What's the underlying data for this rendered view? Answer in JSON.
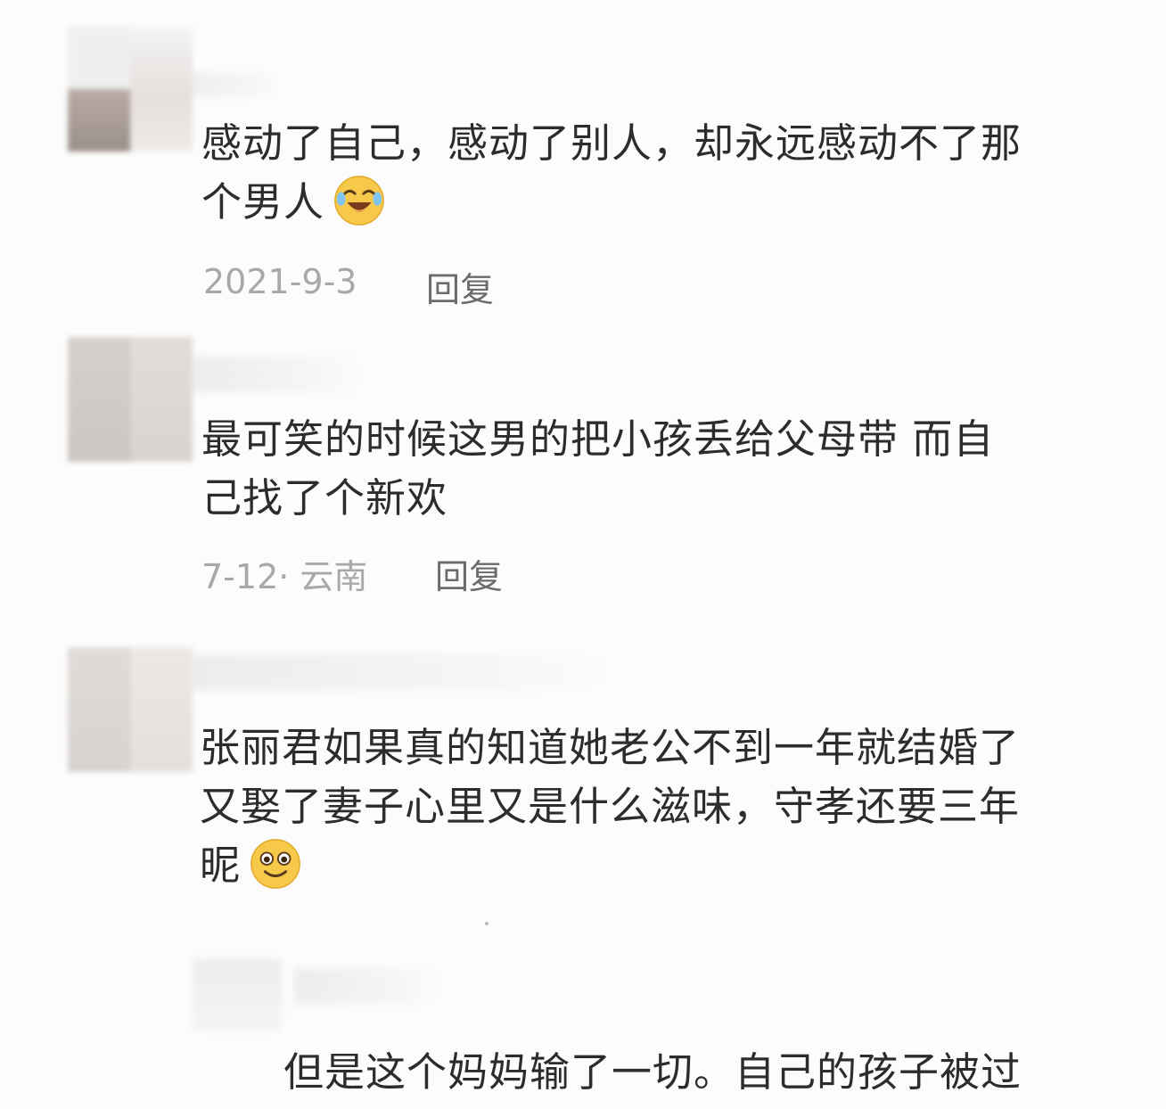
{
  "comments": [
    {
      "line1": "感动了自己，感动了别人，却永远感动不了那",
      "line2": "个男人",
      "emoji": "laughing-crying-face-icon",
      "date": "2021-9-3",
      "reply": "回复"
    },
    {
      "line1": "最可笑的时候这男的把小孩丢给父母带 而自",
      "line2": "己找了个新欢",
      "date": "7-12· 云南",
      "reply": "回复"
    },
    {
      "line1": "张丽君如果真的知道她老公不到一年就结婚了",
      "line2": "又娶了妻子心里又是什么滋味，守孝还要三年",
      "line3": "昵",
      "emoji": "smiling-face-icon"
    },
    {
      "line1": "但是这个妈妈输了一切。自己的孩子被过"
    }
  ],
  "colors": {
    "background": "#fcfcfc",
    "text": "#2c2c2c",
    "meta": "#a8a8a8",
    "reply": "#6b6b6b",
    "emoji": "#f7c94a"
  }
}
